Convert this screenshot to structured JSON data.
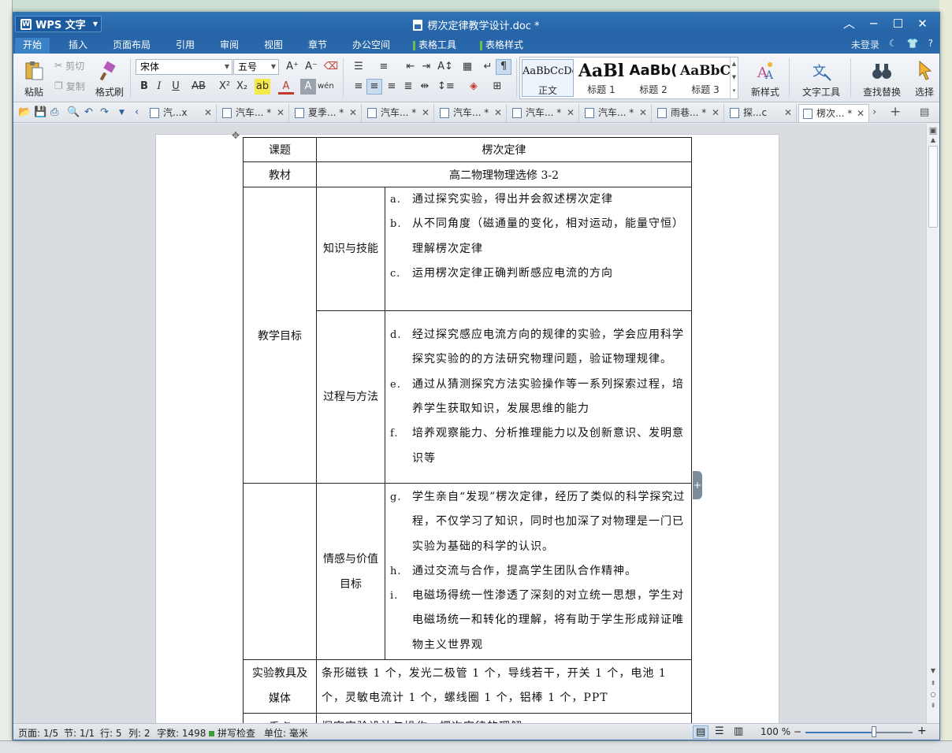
{
  "app": {
    "name": "WPS 文字",
    "doc_title": "楞次定律教学设计.doc *"
  },
  "window_controls": {
    "minimize": "─",
    "maximize": "☐",
    "close": "✕",
    "collapse": "︿"
  },
  "menu": {
    "tabs": [
      "开始",
      "插入",
      "页面布局",
      "引用",
      "审阅",
      "视图",
      "章节",
      "办公空间",
      "表格工具",
      "表格样式"
    ],
    "login": "未登录",
    "help": "?"
  },
  "ribbon": {
    "paste": "粘贴",
    "cut": "剪切",
    "copy": "复制",
    "format_painter": "格式刷",
    "font_name": "宋体",
    "font_size": "五号",
    "styles": [
      {
        "sample": "AaBbCcDd",
        "label": "正文"
      },
      {
        "sample": "AaBl",
        "label": "标题 1"
      },
      {
        "sample": "AaBb(",
        "label": "标题 2"
      },
      {
        "sample": "AaBbC",
        "label": "标题 3"
      }
    ],
    "new_style": "新样式",
    "text_tools": "文字工具",
    "find_replace": "查找替换",
    "select": "选择"
  },
  "doc_tabs": [
    {
      "label": "汽...x",
      "active": false
    },
    {
      "label": "汽车... *",
      "active": false
    },
    {
      "label": "夏季... *",
      "active": false
    },
    {
      "label": "汽车... *",
      "active": false
    },
    {
      "label": "汽车... *",
      "active": false
    },
    {
      "label": "汽车... *",
      "active": false
    },
    {
      "label": "汽车... *",
      "active": false
    },
    {
      "label": "雨巷... *",
      "active": false
    },
    {
      "label": "探...c",
      "active": false
    },
    {
      "label": "楞次... *",
      "active": true
    }
  ],
  "table": {
    "topic_label": "课题",
    "topic_value": "楞次定律",
    "textbook_label": "教材",
    "textbook_value": "高二物理物理选修 3-2",
    "goals_label": "教学目标",
    "knowledge_label": "知识与技能",
    "knowledge_items": [
      {
        "m": "a.",
        "t": "通过探究实验，得出并会叙述楞次定律"
      },
      {
        "m": "b.",
        "t": "从不同角度（磁通量的变化，相对运动，能量守恒）理解楞次定律"
      },
      {
        "m": "c.",
        "t": "运用楞次定律正确判断感应电流的方向"
      }
    ],
    "process_label": "过程与方法",
    "process_items": [
      {
        "m": "d.",
        "t": "经过探究感应电流方向的规律的实验，学会应用科学探究实验的的方法研究物理问题，验证物理规律。"
      },
      {
        "m": "e.",
        "t": "通过从猜测探究方法实验操作等一系列探索过程，培养学生获取知识，发展思维的能力"
      },
      {
        "m": "f.",
        "t": "培养观察能力、分析推理能力以及创新意识、发明意识等"
      }
    ],
    "emotion_label": "情感与价值目标",
    "emotion_items": [
      {
        "m": "g.",
        "t": "学生亲自“发现”楞次定律，经历了类似的科学探究过程，不仅学习了知识，同时也加深了对物理是一门已实验为基础的科学的认识。"
      },
      {
        "m": "h.",
        "t": "通过交流与合作，提高学生团队合作精神。"
      },
      {
        "m": "i.",
        "t": "电磁场得统一性渗透了深刻的对立统一思想，学生对电磁场统一和转化的理解，将有助于学生形成辩证唯物主义世界观"
      }
    ],
    "equipment_label": "实验教具及媒体",
    "equipment_value": "条形磁铁 1 个，发光二极管 1 个，导线若干，开关 1 个，电池 1 个，灵敏电流计 1 个，螺线圈 1 个，铝棒 1 个，PPT",
    "focus_label": "重点",
    "focus_value": "探究实验设计与操作，楞次定律的理解"
  },
  "status": {
    "page": "页面: 1/5",
    "section": "节: 1/1",
    "row": "行: 5",
    "col": "列: 2",
    "words": "字数: 1498",
    "spell": "拼写检查",
    "unit": "单位: 毫米",
    "zoom": "100 %",
    "zoom_level": 0.64
  }
}
